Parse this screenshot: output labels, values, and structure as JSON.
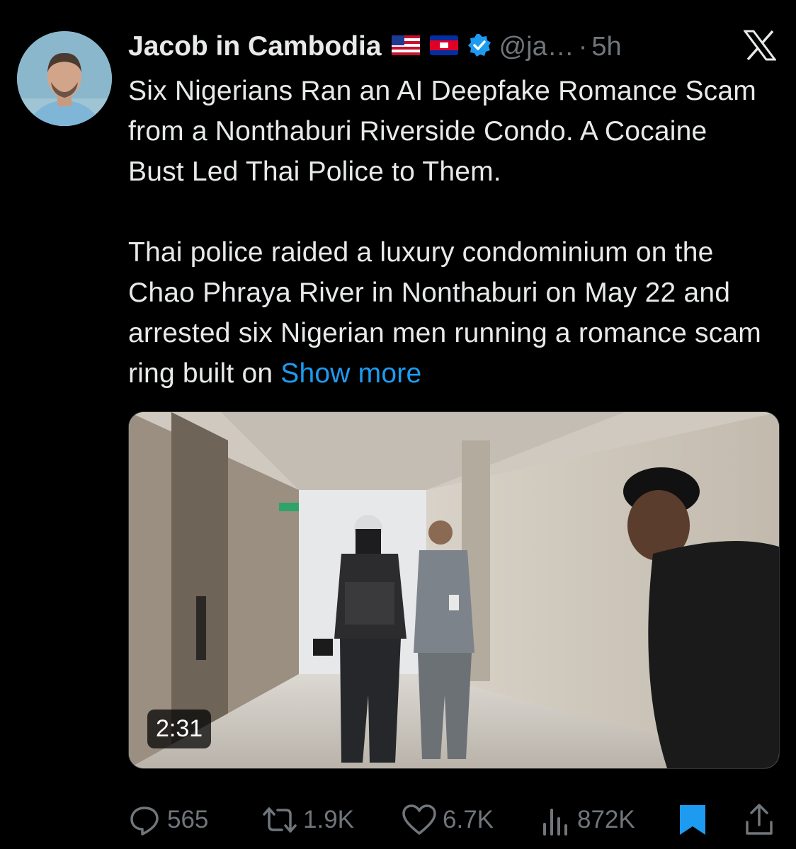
{
  "tweet": {
    "author_name": "Jacob in Cambodia",
    "handle": "@ja…",
    "separator": "·",
    "time": "5h",
    "paragraph1": "Six Nigerians Ran an AI Deepfake Romance Scam from a Nonthaburi Riverside Condo. A Cocaine Bust Led Thai Police to Them.",
    "paragraph2": "Thai police raided a luxury condominium on the Chao Phraya River in Nonthaburi on May 22 and arrested six Nigerian men running a romance scam ring built on",
    "show_more": "Show more"
  },
  "media": {
    "type": "video",
    "duration": "2:31"
  },
  "actions": {
    "replies": "565",
    "reposts": "1.9K",
    "likes": "6.7K",
    "views": "872K"
  },
  "icons": {
    "verified": "verified-badge-icon",
    "platform": "x-logo-icon",
    "reply": "reply-icon",
    "repost": "repost-icon",
    "like": "heart-icon",
    "views": "views-icon",
    "bookmark": "bookmark-icon",
    "share": "share-icon"
  },
  "colors": {
    "background": "#000000",
    "text": "#e7e9ea",
    "muted": "#71767b",
    "accent": "#1d9bf0"
  }
}
